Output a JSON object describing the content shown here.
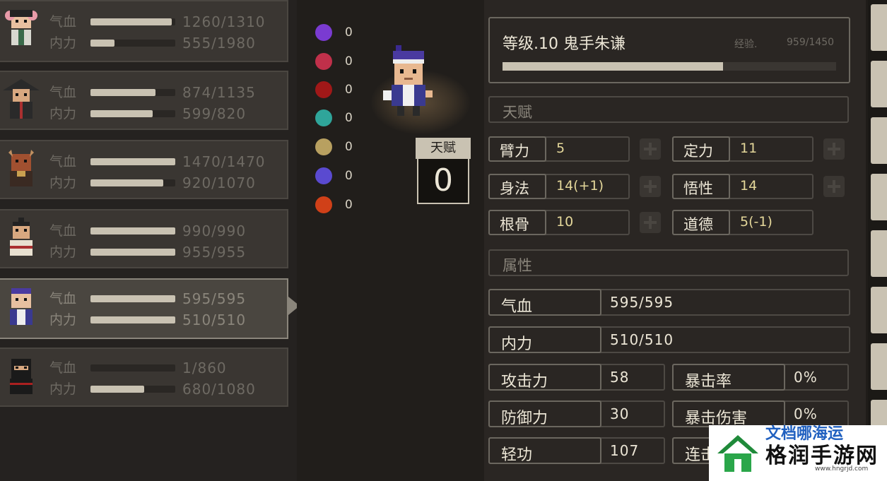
{
  "party": {
    "members": [
      {
        "hp_label": "气血",
        "hp": "1260/1310",
        "hp_frac": 0.96,
        "mp_label": "内力",
        "mp": "555/1980",
        "mp_frac": 0.28,
        "name_icon": "pink-hair-girl-portrait"
      },
      {
        "hp_label": "气血",
        "hp": "874/1135",
        "hp_frac": 0.77,
        "mp_label": "内力",
        "mp": "599/820",
        "mp_frac": 0.73,
        "name_icon": "straw-hat-warrior-portrait"
      },
      {
        "hp_label": "气血",
        "hp": "1470/1470",
        "hp_frac": 1.0,
        "mp_label": "内力",
        "mp": "920/1070",
        "mp_frac": 0.86,
        "name_icon": "horned-monk-portrait"
      },
      {
        "hp_label": "气血",
        "hp": "990/990",
        "hp_frac": 1.0,
        "mp_label": "内力",
        "mp": "955/955",
        "mp_frac": 1.0,
        "name_icon": "topknot-swordsman-portrait"
      },
      {
        "hp_label": "气血",
        "hp": "595/595",
        "hp_frac": 1.0,
        "mp_label": "内力",
        "mp": "510/510",
        "mp_frac": 1.0,
        "name_icon": "purple-headband-hero-portrait",
        "selected": true
      },
      {
        "hp_label": "气血",
        "hp": "1/860",
        "hp_frac": 0.0,
        "mp_label": "内力",
        "mp": "680/1080",
        "mp_frac": 0.63,
        "name_icon": "black-ninja-portrait"
      }
    ]
  },
  "status_effects": [
    {
      "icon": "skull-icon",
      "count": "0",
      "color": "#7a3bd1"
    },
    {
      "icon": "broken-heart-icon",
      "count": "0",
      "color": "#c0304a"
    },
    {
      "icon": "blood-splat-icon",
      "count": "0",
      "color": "#a01818"
    },
    {
      "icon": "cyan-skull-icon",
      "count": "0",
      "color": "#2fa59a"
    },
    {
      "icon": "dizzy-star-icon",
      "count": "0",
      "color": "#b8a060"
    },
    {
      "icon": "frozen-orb-icon",
      "count": "0",
      "color": "#5a4ad0"
    },
    {
      "icon": "flame-icon",
      "count": "0",
      "color": "#d04018"
    }
  ],
  "talent_points": {
    "label": "天赋",
    "value": "0"
  },
  "character": {
    "level_name": "等级.10  鬼手朱谦",
    "exp_label": "经验.",
    "exp_value": "959/1450",
    "exp_frac": 0.66
  },
  "talents_section": "天赋",
  "attributes": [
    {
      "label": "臂力",
      "value": "5"
    },
    {
      "label": "定力",
      "value": "11"
    },
    {
      "label": "身法",
      "value": "14(+1)"
    },
    {
      "label": "悟性",
      "value": "14"
    },
    {
      "label": "根骨",
      "value": "10"
    },
    {
      "label": "道德",
      "value": "5(-1)"
    }
  ],
  "props_section": "属性",
  "props": {
    "hp": {
      "label": "气血",
      "value": "595/595"
    },
    "mp": {
      "label": "内力",
      "value": "510/510"
    },
    "atk": {
      "label": "攻击力",
      "value": "58"
    },
    "crit_rate": {
      "label": "暴击率",
      "value": "0%"
    },
    "def": {
      "label": "防御力",
      "value": "30"
    },
    "crit_dmg": {
      "label": "暴击伤害",
      "value": "0%"
    },
    "qinggong": {
      "label": "轻功",
      "value": "107"
    },
    "combo": {
      "label": "连击",
      "value": ""
    }
  },
  "watermark": {
    "title": "格润手游网",
    "url": "www.hngrjd.com",
    "top": "文档哪海运"
  },
  "colors": {
    "accent": "#c9c2b2",
    "value_yellow": "#e4d79a",
    "panel": "#2a2623"
  }
}
